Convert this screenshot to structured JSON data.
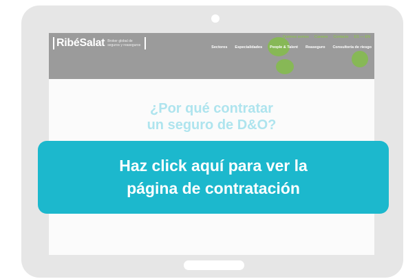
{
  "site": {
    "logo_name": "RibéSalat",
    "logo_tagline": "Broker global de seguros y reaseguros",
    "top_links": [
      "Quiénes somos",
      "Careers",
      "Contacto",
      "ES — EN"
    ],
    "nav_items": [
      "Sectores",
      "Especialidades",
      "People & Talent",
      "Reaseguro",
      "Consultoría de riesgo"
    ],
    "heading": "¿Por qué contratar\nun seguro de D&O?"
  },
  "cta": {
    "label": "Haz click aquí para ver la\npágina de contratación"
  },
  "colors": {
    "tablet_frame": "#e6e6e6",
    "cta_background": "#1cb8cd",
    "header_overlay": "#9b9b9b",
    "heading": "#aee4ee",
    "accent_green": "#8acb3e"
  }
}
